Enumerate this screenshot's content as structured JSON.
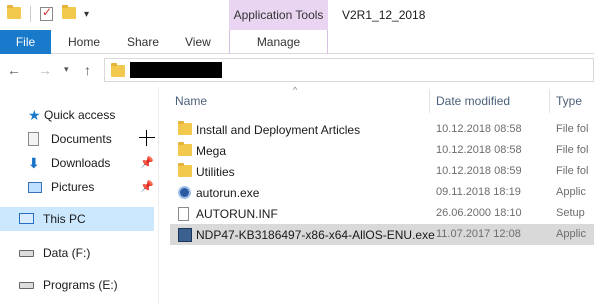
{
  "window": {
    "title": "V2R1_12_2018",
    "contextual_tab_group": "Application Tools"
  },
  "ribbon": {
    "tabs": {
      "file": "File",
      "home": "Home",
      "share": "Share",
      "view": "View",
      "manage": "Manage"
    }
  },
  "address": {
    "path_redacted": true
  },
  "nav_pane": {
    "items": [
      {
        "label": "Quick access",
        "icon": "star-icon"
      },
      {
        "label": "Documents",
        "icon": "documents-icon",
        "pinned": true
      },
      {
        "label": "Downloads",
        "icon": "downloads-icon",
        "pinned": true
      },
      {
        "label": "Pictures",
        "icon": "pictures-icon",
        "pinned": true
      },
      {
        "label": "This PC",
        "icon": "computer-icon",
        "selected": true
      },
      {
        "label": "Data (F:)",
        "icon": "drive-icon"
      },
      {
        "label": "Programs (E:)",
        "icon": "drive-icon"
      }
    ],
    "pin_glyph": "†"
  },
  "file_list": {
    "columns": {
      "name": "Name",
      "date": "Date modified",
      "type": "Type"
    },
    "rows": [
      {
        "name": "Install and Deployment Articles",
        "date": "10.12.2018 08:58",
        "type": "File fol",
        "icon": "folder-icon"
      },
      {
        "name": "Mega",
        "date": "10.12.2018 08:58",
        "type": "File fol",
        "icon": "folder-icon"
      },
      {
        "name": "Utilities",
        "date": "10.12.2018 08:59",
        "type": "File fol",
        "icon": "folder-icon"
      },
      {
        "name": "autorun.exe",
        "date": "09.11.2018 18:19",
        "type": "Applic",
        "icon": "exe-icon"
      },
      {
        "name": "AUTORUN.INF",
        "date": "26.06.2000 18:10",
        "type": "Setup",
        "icon": "inf-icon"
      },
      {
        "name": "NDP47-KB3186497-x86-x64-AllOS-ENU.exe",
        "date": "11.07.2017 12:08",
        "type": "Applic",
        "icon": "setup-exe-icon",
        "selected": true
      }
    ]
  },
  "colors": {
    "file_tab": "#1979ca",
    "app_tools": "#e9d5f2",
    "selection": "#cce8ff",
    "row_selected": "#d9d9d9"
  }
}
